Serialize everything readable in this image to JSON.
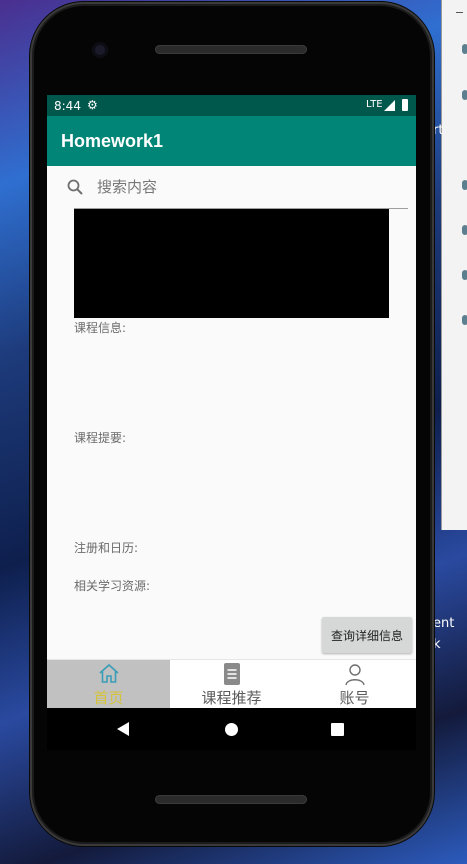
{
  "status_bar": {
    "time": "8:44",
    "network": "LTE"
  },
  "app_bar": {
    "title": "Homework1"
  },
  "search": {
    "placeholder": "搜索内容"
  },
  "labels": {
    "course_info": "课程信息:",
    "course_summary": "课程提要:",
    "registration_calendar": "注册和日历:",
    "related_resources": "相关学习资源:"
  },
  "detail_button": {
    "label": "查询详细信息"
  },
  "bottom_nav": {
    "items": [
      {
        "label": "首页",
        "icon": "home-icon",
        "active": true
      },
      {
        "label": "课程推荐",
        "icon": "document-icon",
        "active": false
      },
      {
        "label": "账号",
        "icon": "person-icon",
        "active": false
      }
    ]
  },
  "desktop_side": {
    "text_1": "rt",
    "text_2": "ent",
    "text_3": "k"
  },
  "colors": {
    "status_bar": "#00574b",
    "app_bar": "#008577",
    "active_nav_bg": "#c1c1c1",
    "active_nav_label": "#d4c23b"
  }
}
